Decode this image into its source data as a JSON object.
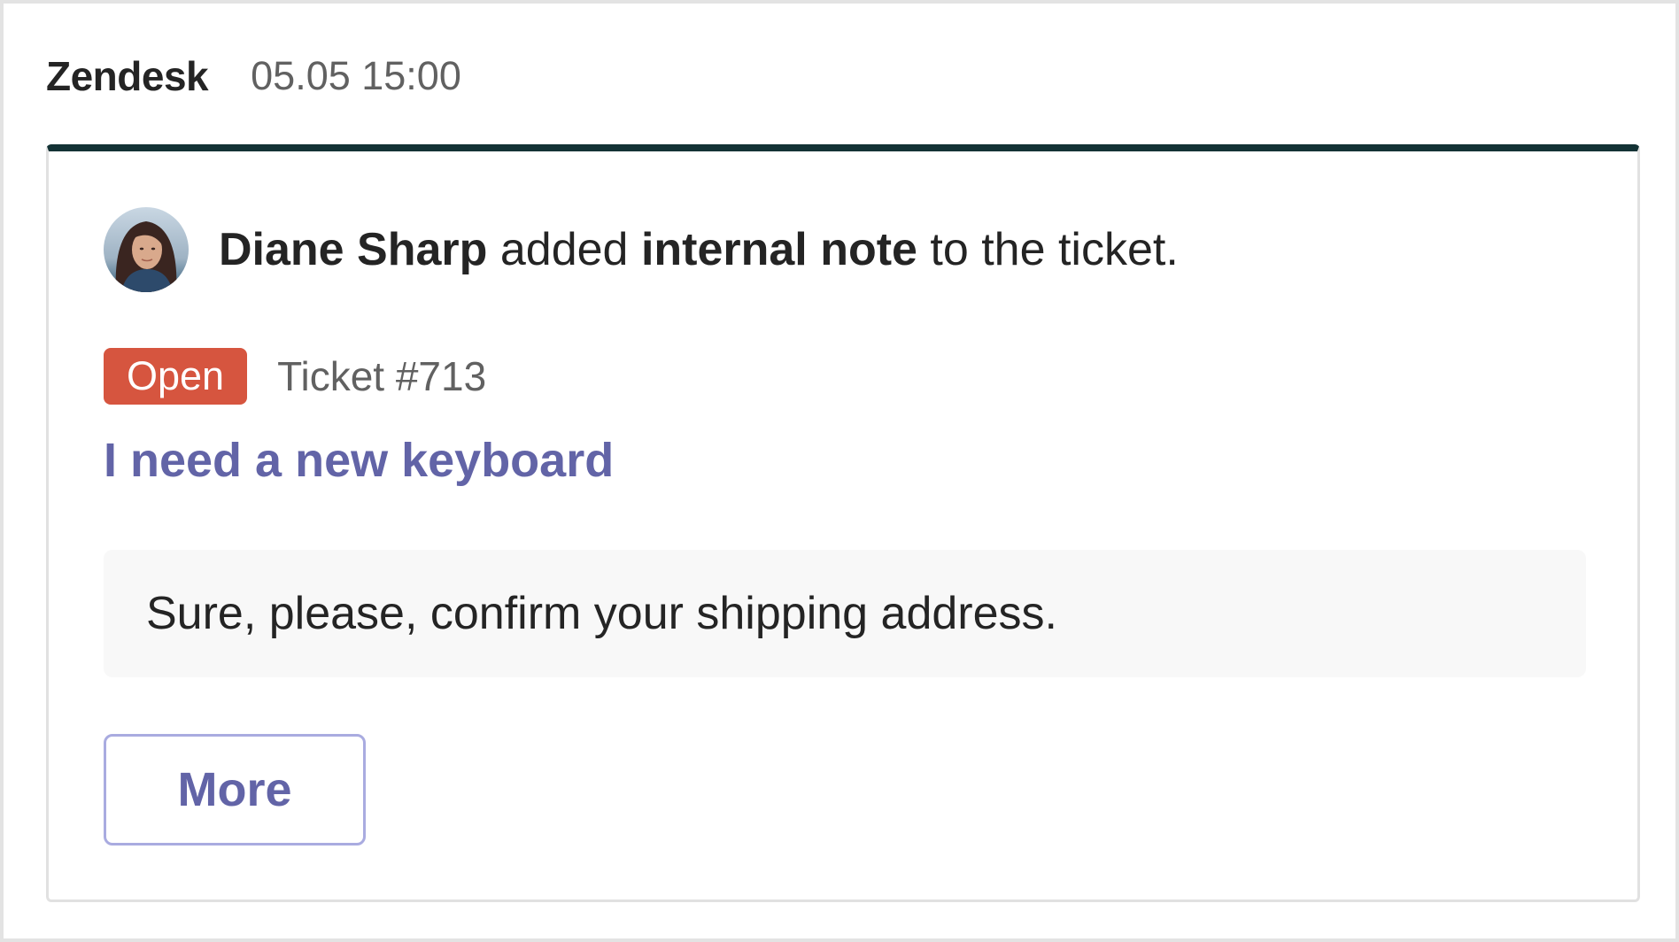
{
  "header": {
    "app_name": "Zendesk",
    "timestamp": "05.05 15:00"
  },
  "activity": {
    "avatar_icon": "user-avatar-photo",
    "actor": "Diane Sharp",
    "verb": "added",
    "object": "internal note",
    "suffix": "to the ticket."
  },
  "ticket": {
    "status": "Open",
    "number": "Ticket #713",
    "title": "I need a new keyboard",
    "note": "Sure, please, confirm your shipping address."
  },
  "actions": {
    "more_label": "More"
  },
  "colors": {
    "accent_bar": "#133235",
    "status_open": "#d6553f",
    "link": "#6264a7",
    "button_border": "#a9abe0"
  }
}
